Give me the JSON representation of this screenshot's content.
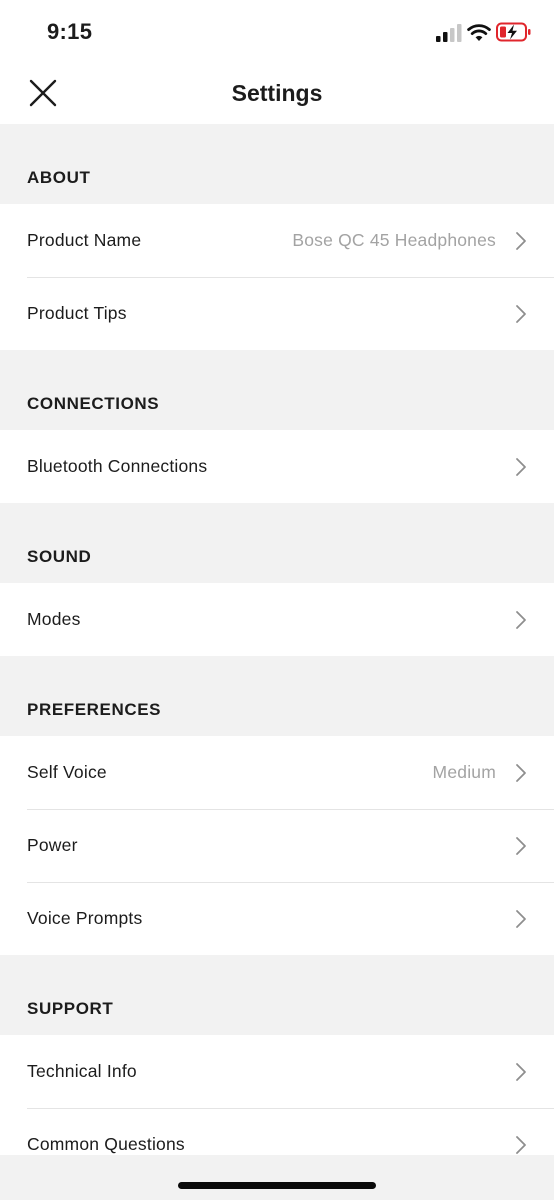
{
  "status_bar": {
    "time": "9:15",
    "icons": [
      "signal-icon",
      "wifi-icon",
      "battery-charging-icon"
    ],
    "battery_color": "#e0262c"
  },
  "nav": {
    "title": "Settings",
    "close_icon": "close-icon"
  },
  "sections": [
    {
      "header": "ABOUT",
      "rows": [
        {
          "label": "Product Name",
          "value": "Bose QC 45 Headphones"
        },
        {
          "label": "Product Tips",
          "value": ""
        }
      ]
    },
    {
      "header": "CONNECTIONS",
      "rows": [
        {
          "label": "Bluetooth Connections",
          "value": ""
        }
      ]
    },
    {
      "header": "SOUND",
      "rows": [
        {
          "label": "Modes",
          "value": ""
        }
      ]
    },
    {
      "header": "PREFERENCES",
      "rows": [
        {
          "label": "Self Voice",
          "value": "Medium"
        },
        {
          "label": "Power",
          "value": ""
        },
        {
          "label": "Voice Prompts",
          "value": ""
        }
      ]
    },
    {
      "header": "SUPPORT",
      "rows": [
        {
          "label": "Technical Info",
          "value": ""
        },
        {
          "label": "Common Questions",
          "value": ""
        }
      ]
    }
  ],
  "colors": {
    "background": "#f2f2f2",
    "row_background": "#ffffff",
    "text": "#1c1c1c",
    "secondary_text": "#a3a3a3",
    "chevron": "#8e8e8e"
  }
}
